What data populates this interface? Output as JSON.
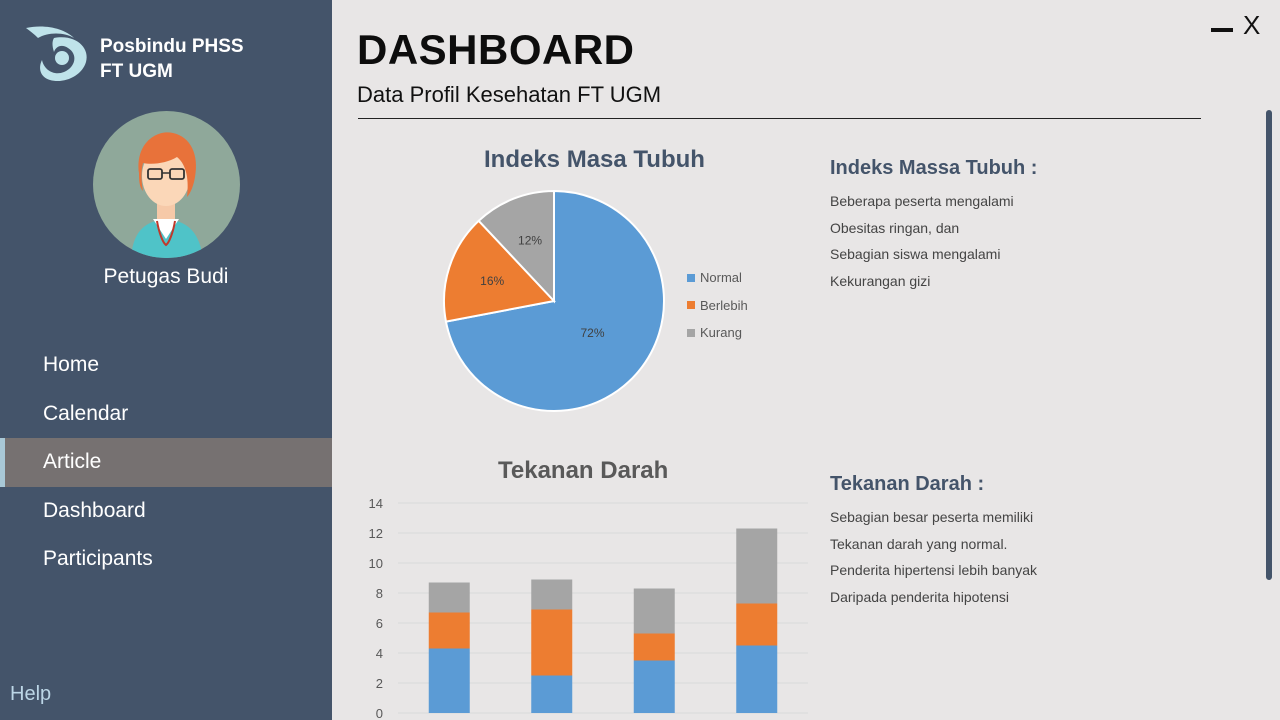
{
  "app": {
    "brand_line1": "Posbindu PHSS",
    "brand_line2": "FT UGM"
  },
  "user": {
    "name": "Petugas Budi"
  },
  "nav": {
    "items": [
      {
        "label": "Home",
        "active": false
      },
      {
        "label": "Calendar",
        "active": false
      },
      {
        "label": "Article",
        "active": true
      },
      {
        "label": "Dashboard",
        "active": false
      },
      {
        "label": "Participants",
        "active": false
      }
    ],
    "help": "Help"
  },
  "window": {
    "close_glyph": "X"
  },
  "header": {
    "title": "DASHBOARD",
    "subtitle": "Data Profil Kesehatan FT UGM"
  },
  "bmi_panel": {
    "title": "Indeks Massa Tubuh :",
    "lines": [
      "Beberapa peserta mengalami",
      "Obesitas ringan, dan",
      "Sebagian siswa mengalami",
      "Kekurangan gizi"
    ]
  },
  "bp_panel": {
    "title": "Tekanan Darah :",
    "lines": [
      "Sebagian besar peserta memiliki",
      "Tekanan darah yang normal.",
      "Penderita hipertensi lebih banyak",
      "Daripada penderita hipotensi"
    ]
  },
  "colors": {
    "sidebar": "#44546a",
    "active_nav": "#767171",
    "blue": "#5b9bd5",
    "orange": "#ed7d31",
    "gray": "#a5a5a5"
  },
  "chart_data": [
    {
      "type": "pie",
      "title": "Indeks Masa Tubuh",
      "labels": [
        "Normal",
        "Berlebih",
        "Kurang"
      ],
      "values": [
        72,
        16,
        12
      ],
      "value_labels": [
        "72%",
        "16%",
        "12%"
      ],
      "colors": [
        "#5b9bd5",
        "#ed7d31",
        "#a5a5a5"
      ],
      "legend": "right"
    },
    {
      "type": "bar",
      "stacked": true,
      "title": "Tekanan Darah",
      "categories": [
        "",
        "",
        "",
        ""
      ],
      "series": [
        {
          "values": [
            4.3,
            2.5,
            3.5,
            4.5
          ],
          "color": "#5b9bd5"
        },
        {
          "values": [
            2.4,
            4.4,
            1.8,
            2.8
          ],
          "color": "#ed7d31"
        },
        {
          "values": [
            2.0,
            2.0,
            3.0,
            5.0
          ],
          "color": "#a5a5a5"
        }
      ],
      "yticks": [
        "0",
        "2",
        "4",
        "6",
        "8",
        "10",
        "12",
        "14"
      ],
      "ylim": [
        0,
        14
      ],
      "grid": true
    }
  ]
}
